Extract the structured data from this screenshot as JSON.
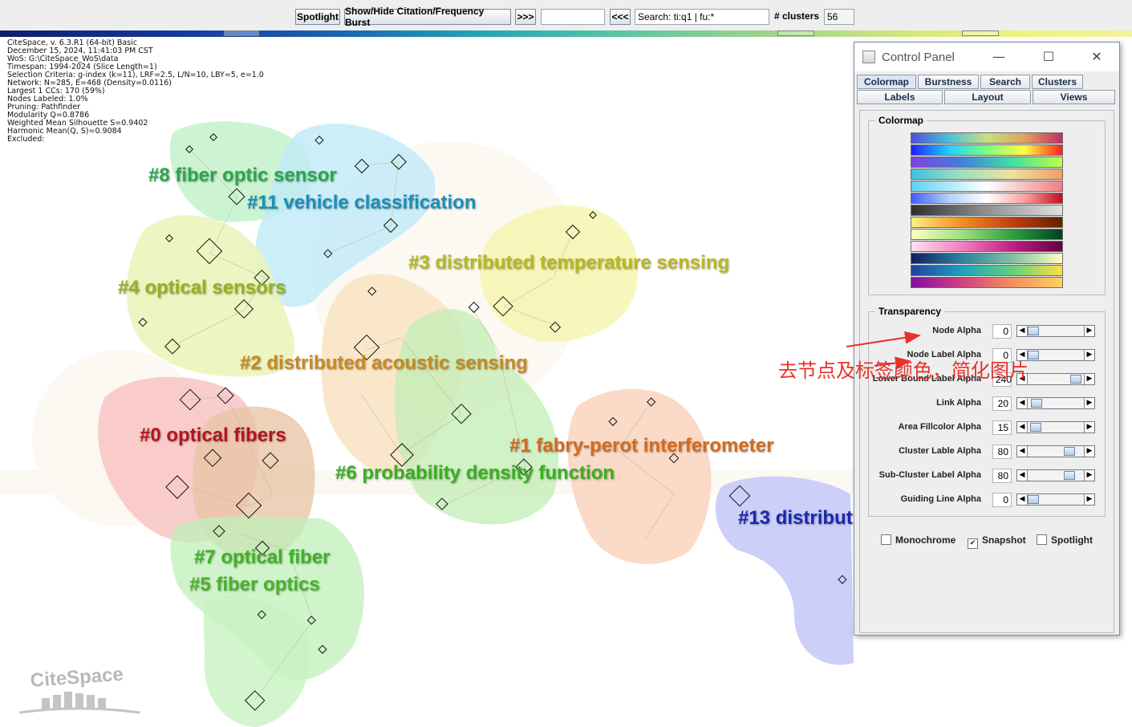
{
  "toolbar": {
    "spotlight_label": "Spotlight",
    "burst_label": "Show/Hide Citation/Frequency Burst",
    "next_label": ">>>",
    "prev_label": "<<<",
    "search_value": "Search: ti:q1 | fu:*",
    "clusters_label": "# clusters",
    "clusters_value": "56"
  },
  "info_lines": [
    "CiteSpace, v. 6.3.R1 (64-bit) Basic",
    "December 15, 2024, 11:41:03 PM CST",
    "WoS: G:\\CiteSpace_WoS\\data",
    "Timespan: 1994-2024 (Slice Length=1)",
    "Selection Criteria: g-index (k=11), LRF=2.5, L/N=10, LBY=5, e=1.0",
    "Network: N=285, E=468 (Density=0.0116)",
    "Largest 1 CCs: 170 (59%)",
    "Nodes Labeled: 1.0%",
    "Pruning: Pathfinder",
    "Modularity Q=0.8786",
    "Weighted Mean Silhouette S=0.9402",
    "Harmonic Mean(Q, S)=0.9084",
    "Excluded:"
  ],
  "clusters": [
    {
      "label": "#8 fiber optic sensor",
      "color": "#2aa84a"
    },
    {
      "label": "#11 vehicle classification",
      "color": "#1a8fb8"
    },
    {
      "label": "#3 distributed temperature sensing",
      "color": "#b8b81e"
    },
    {
      "label": "#4 optical sensors",
      "color": "#94b41c"
    },
    {
      "label": "#2 distributed acoustic sensing",
      "color": "#c88a1e"
    },
    {
      "label": "#0 optical fibers",
      "color": "#b4141c"
    },
    {
      "label": "#1 fabry-perot interferometer",
      "color": "#d46a1e"
    },
    {
      "label": "#6 probability density function",
      "color": "#38b020"
    },
    {
      "label": "#13 distribut",
      "color": "#1a28b0"
    },
    {
      "label": "#7 optical fiber",
      "color": "#3cb424"
    },
    {
      "label": "#5 fiber optics",
      "color": "#48b428"
    }
  ],
  "annotation": "去节点及标签颜色，简化图片",
  "logo_text": "CiteSpace",
  "control_panel": {
    "title": "Control Panel",
    "minimize": "—",
    "maximize": "☐",
    "close": "✕",
    "tabs_row1": [
      "Colormap",
      "Burstness",
      "Search",
      "Clusters"
    ],
    "tabs_row2": [
      "Labels",
      "Layout",
      "Views"
    ],
    "colormap_legend": "Colormap",
    "transparency_legend": "Transparency",
    "sliders": [
      {
        "label": "Node Alpha",
        "value": "0",
        "level": 0.0
      },
      {
        "label": "Node Label Alpha",
        "value": "0",
        "level": 0.0
      },
      {
        "label": "Lower Bound Label Alpha",
        "value": "240",
        "level": 0.94
      },
      {
        "label": "Link Alpha",
        "value": "20",
        "level": 0.08
      },
      {
        "label": "Area Fillcolor Alpha",
        "value": "15",
        "level": 0.06
      },
      {
        "label": "Cluster Lable Alpha",
        "value": "80",
        "level": 0.8
      },
      {
        "label": "Sub-Cluster Label Alpha",
        "value": "80",
        "level": 0.8
      },
      {
        "label": "Guiding Line Alpha",
        "value": "0",
        "level": 0.0
      }
    ],
    "checkboxes": [
      {
        "label": "Monochrome",
        "checked": false
      },
      {
        "label": "Snapshot",
        "checked": true
      },
      {
        "label": "Spotlight",
        "checked": false
      }
    ]
  }
}
